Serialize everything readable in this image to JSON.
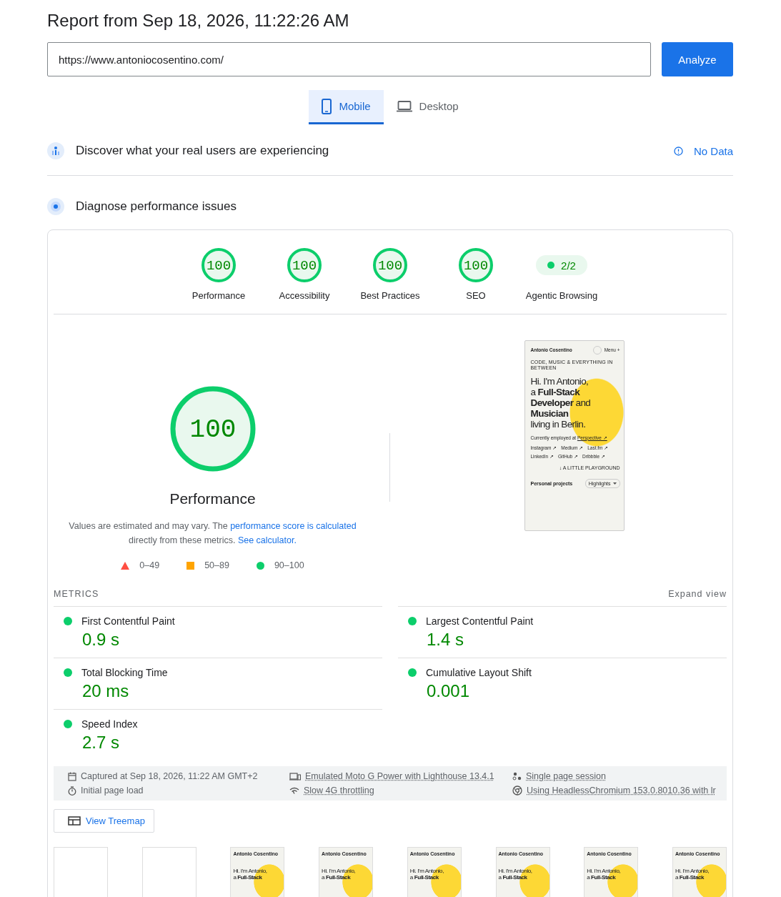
{
  "report_title": "Report from Sep 18, 2026, 11:22:26 AM",
  "url_field": {
    "value": "https://www.antoniocosentino.com/"
  },
  "analyze_button": "Analyze",
  "device_tabs": [
    {
      "label": "Mobile",
      "kind": "mobile",
      "selected": true
    },
    {
      "label": "Desktop",
      "kind": "desktop",
      "selected": false
    }
  ],
  "field_data": {
    "title": "Discover what your real users are experiencing",
    "status": "No Data"
  },
  "lab_data": {
    "title": "Diagnose performance issues"
  },
  "gauges": [
    {
      "kind": "score",
      "value": "100",
      "label": "Performance"
    },
    {
      "kind": "score",
      "value": "100",
      "label": "Accessibility"
    },
    {
      "kind": "score",
      "value": "100",
      "label": "Best Practices"
    },
    {
      "kind": "score",
      "value": "100",
      "label": "SEO"
    },
    {
      "kind": "fraction",
      "value": "2/2",
      "label": "Agentic Browsing"
    }
  ],
  "main_gauge": {
    "value": "100",
    "label": "Performance",
    "description": {
      "intro": "Values are estimated and may vary. The",
      "score_link": "performance score is calculated",
      "middle": "directly from these metrics.",
      "calculator_link": "See calculator."
    }
  },
  "legend": [
    {
      "kind": "fail",
      "range": "0–49"
    },
    {
      "kind": "average",
      "range": "50–89"
    },
    {
      "kind": "pass",
      "range": "90–100"
    }
  ],
  "preview": {
    "site_name": "Antonio Cosentino",
    "menu": "Menu +",
    "tagline": "CODE, MUSIC & EVERYTHING IN BETWEEN",
    "headline": [
      "Hi. I'm Antonio,",
      "a **Full-Stack**",
      "**Developer** and",
      "**Musician**",
      "living in Berlin."
    ],
    "employment": "Currently employed at",
    "employer": "Perspective ↗",
    "links": [
      "Instagram ↗",
      "Medium ↗",
      "Last.fm ↗",
      "LinkedIn ↗",
      "GitHub ↗",
      "Dribbble ↗"
    ],
    "playground": "↓ A LITTLE PLAYGROUND",
    "projects_title": "Personal projects",
    "projects_filter": "Highlights"
  },
  "metrics": {
    "heading": "METRICS",
    "toggle": "Expand view",
    "items": [
      {
        "name": "First Contentful Paint",
        "value": "0.9 s"
      },
      {
        "name": "Largest Contentful Paint",
        "value": "1.4 s"
      },
      {
        "name": "Total Blocking Time",
        "value": "20 ms"
      },
      {
        "name": "Cumulative Layout Shift",
        "value": "0.001"
      },
      {
        "name": "Speed Index",
        "value": "2.7 s"
      }
    ]
  },
  "environment": [
    {
      "kind": "calendar",
      "text": "Captured at Sep 18, 2026, 11:22 AM GMT+2"
    },
    {
      "kind": "device",
      "text": "Emulated Moto G Power with Lighthouse 13.4.1"
    },
    {
      "kind": "session",
      "text": "Single page session"
    },
    {
      "kind": "timer",
      "text": "Initial page load"
    },
    {
      "kind": "network",
      "text": "Slow 4G throttling"
    },
    {
      "kind": "browser",
      "text": "Using HeadlessChromium 153.0.8010.36 with lr"
    }
  ],
  "treemap_button": "View Treemap",
  "filmstrip": [
    {
      "kind": "blank"
    },
    {
      "kind": "blank"
    },
    {
      "kind": "page",
      "site_name": "Antonio Cosentino",
      "headline": [
        "Hi. I'm Antonio,",
        "a **Full-Stack**"
      ]
    },
    {
      "kind": "page",
      "site_name": "Antonio Cosentino",
      "headline": [
        "Hi. I'm Antonio,",
        "a **Full-Stack**"
      ]
    },
    {
      "kind": "page",
      "site_name": "Antonio Cosentino",
      "headline": [
        "Hi. I'm Antonio,",
        "a **Full-Stack**"
      ]
    },
    {
      "kind": "page",
      "site_name": "Antonio Cosentino",
      "headline": [
        "Hi. I'm Antonio,",
        "a **Full-Stack**"
      ]
    },
    {
      "kind": "page",
      "site_name": "Antonio Cosentino",
      "headline": [
        "Hi. I'm Antonio,",
        "a **Full-Stack**"
      ]
    },
    {
      "kind": "page",
      "site_name": "Antonio Cosentino",
      "headline": [
        "Hi. I'm Antonio,",
        "a **Full-Stack**"
      ]
    }
  ]
}
